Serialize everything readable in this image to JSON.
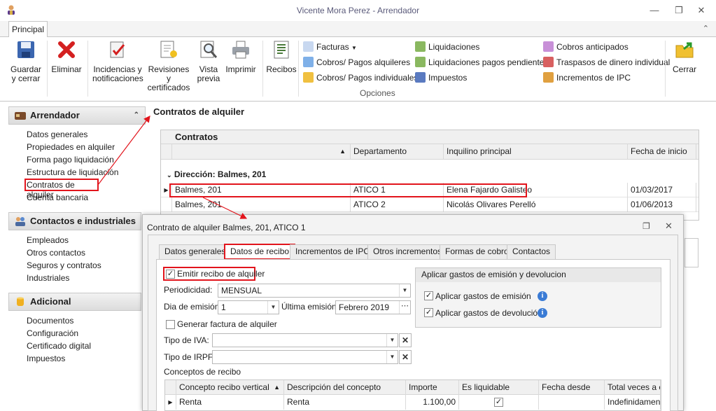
{
  "window": {
    "title": "Vicente Mora Perez - Arrendador"
  },
  "ribbon": {
    "tab": "Principal",
    "buttons": [
      {
        "id": "guardar",
        "label1": "Guardar",
        "label2": "y cerrar"
      },
      {
        "id": "eliminar",
        "label1": "Eliminar",
        "label2": ""
      },
      {
        "id": "incidencias",
        "label1": "Incidencias y",
        "label2": "notificaciones"
      },
      {
        "id": "revisiones",
        "label1": "Revisiones y",
        "label2": "certificados"
      },
      {
        "id": "vista",
        "label1": "Vista",
        "label2": "previa"
      },
      {
        "id": "imprimir",
        "label1": "Imprimir",
        "label2": ""
      },
      {
        "id": "recibos",
        "label1": "Recibos",
        "label2": ""
      },
      {
        "id": "cerrar",
        "label1": "Cerrar",
        "label2": ""
      }
    ],
    "small": {
      "facturas": "Facturas",
      "cobros_alquileres": "Cobros/ Pagos alquileres",
      "cobros_individuales": "Cobros/ Pagos individuales",
      "liquidaciones": "Liquidaciones",
      "liquidaciones_pendientes": "Liquidaciones pagos pendientes",
      "impuestos": "Impuestos",
      "cobros_anticipados": "Cobros anticipados",
      "traspasos": "Traspasos de dinero individual",
      "incrementos_ipc": "Incrementos de IPC"
    },
    "group_label": "Opciones"
  },
  "sidebar": {
    "sections": [
      {
        "title": "Arrendador",
        "items": [
          "Datos generales",
          "Propiedades en alquiler",
          "Forma pago liquidación",
          "Estructura de liquidación",
          "Contratos de alquiler",
          "Cuenta bancaria"
        ]
      },
      {
        "title": "Contactos e industriales",
        "items": [
          "Empleados",
          "Otros contactos",
          "Seguros y contratos",
          "Industriales"
        ]
      },
      {
        "title": "Adicional",
        "items": [
          "Documentos",
          "Configuración",
          "Certificado digital",
          "Impuestos"
        ]
      }
    ]
  },
  "main": {
    "title": "Contratos de alquiler",
    "grid": {
      "caption": "Contratos",
      "columns": [
        "",
        "Departamento",
        "Inquilino principal",
        "Fecha de inicio"
      ],
      "group_row": "Dirección: Balmes, 201",
      "rows": [
        {
          "address": "Balmes, 201",
          "dept": "ATICO 1",
          "tenant": "Elena Fajardo Galisteo",
          "start": "01/03/2017"
        },
        {
          "address": "Balmes, 201",
          "dept": "ATICO 2",
          "tenant": "Nicolás Olivares Perelló",
          "start": "01/06/2013"
        }
      ]
    }
  },
  "dialog": {
    "title": "Contrato de alquiler Balmes, 201, ATICO 1",
    "tabs": [
      "Datos generales",
      "Datos de recibo",
      "Incrementos de IPC",
      "Otros incrementos",
      "Formas de cobro",
      "Contactos"
    ],
    "emitir_label": "Emitir recibo de alquiler",
    "periodicidad_label": "Periodicidad:",
    "periodicidad_value": "MENSUAL",
    "dia_emision_label": "Dia de emisión:",
    "dia_emision_value": "1",
    "ultima_emision_label": "Última emisión:",
    "ultima_emision_value": "Febrero 2019",
    "generar_factura_label": "Generar factura de alquiler",
    "tipo_iva_label": "Tipo de IVA:",
    "tipo_irpf_label": "Tipo de IRPF:",
    "conceptos_label": "Conceptos de recibo",
    "gastos_title": "Aplicar gastos de emisión y devolucion",
    "gastos_emision": "Aplicar gastos de emisión",
    "gastos_devolucion": "Aplicar gastos de devolución",
    "conceptos_grid": {
      "columns": [
        "Concepto recibo vertical",
        "Descripción del concepto",
        "Importe",
        "Es liquidable",
        "Fecha desde",
        "Total veces a em"
      ],
      "row": {
        "concepto": "Renta",
        "descripcion": "Renta",
        "importe": "1.100,00",
        "liquidable": true,
        "fecha": "",
        "total": "Indefinidamente"
      }
    }
  }
}
